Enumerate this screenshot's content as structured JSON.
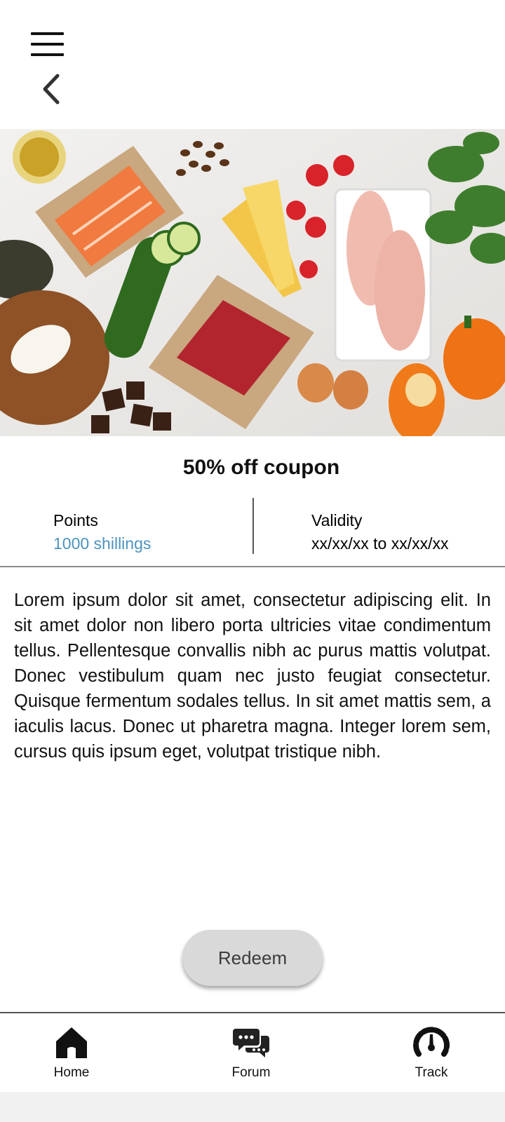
{
  "header": {
    "menu_icon": "hamburger-menu-icon",
    "back_icon": "chevron-left-icon"
  },
  "hero": {
    "image_description_icon": "food-image"
  },
  "coupon": {
    "title": "50% off coupon",
    "points_label": "Points",
    "points_value": "1000 shillings",
    "validity_label": "Validity",
    "validity_value": "xx/xx/xx to xx/xx/xx",
    "description": "Lorem ipsum dolor sit amet, consectetur adipiscing elit. In sit amet dolor non libero porta ultricies vitae condimentum tellus. Pellentesque convallis nibh ac purus mattis volutpat. Donec vestibulum quam nec justo feugiat consectetur. Quisque fermentum sodales tellus. In sit amet mattis sem, a iaculis lacus. Donec ut pharetra magna. Integer lorem sem, cursus quis ipsum eget, volutpat tristique nibh."
  },
  "actions": {
    "redeem_label": "Redeem"
  },
  "bottom_nav": {
    "items": [
      {
        "label": "Home",
        "icon": "home-icon"
      },
      {
        "label": "Forum",
        "icon": "chat-bubbles-icon"
      },
      {
        "label": "Track",
        "icon": "speedometer-icon"
      }
    ]
  },
  "colors": {
    "points_value": "#4c93bf",
    "button_bg": "#d9d9d9",
    "button_text": "#3c3c3c"
  }
}
